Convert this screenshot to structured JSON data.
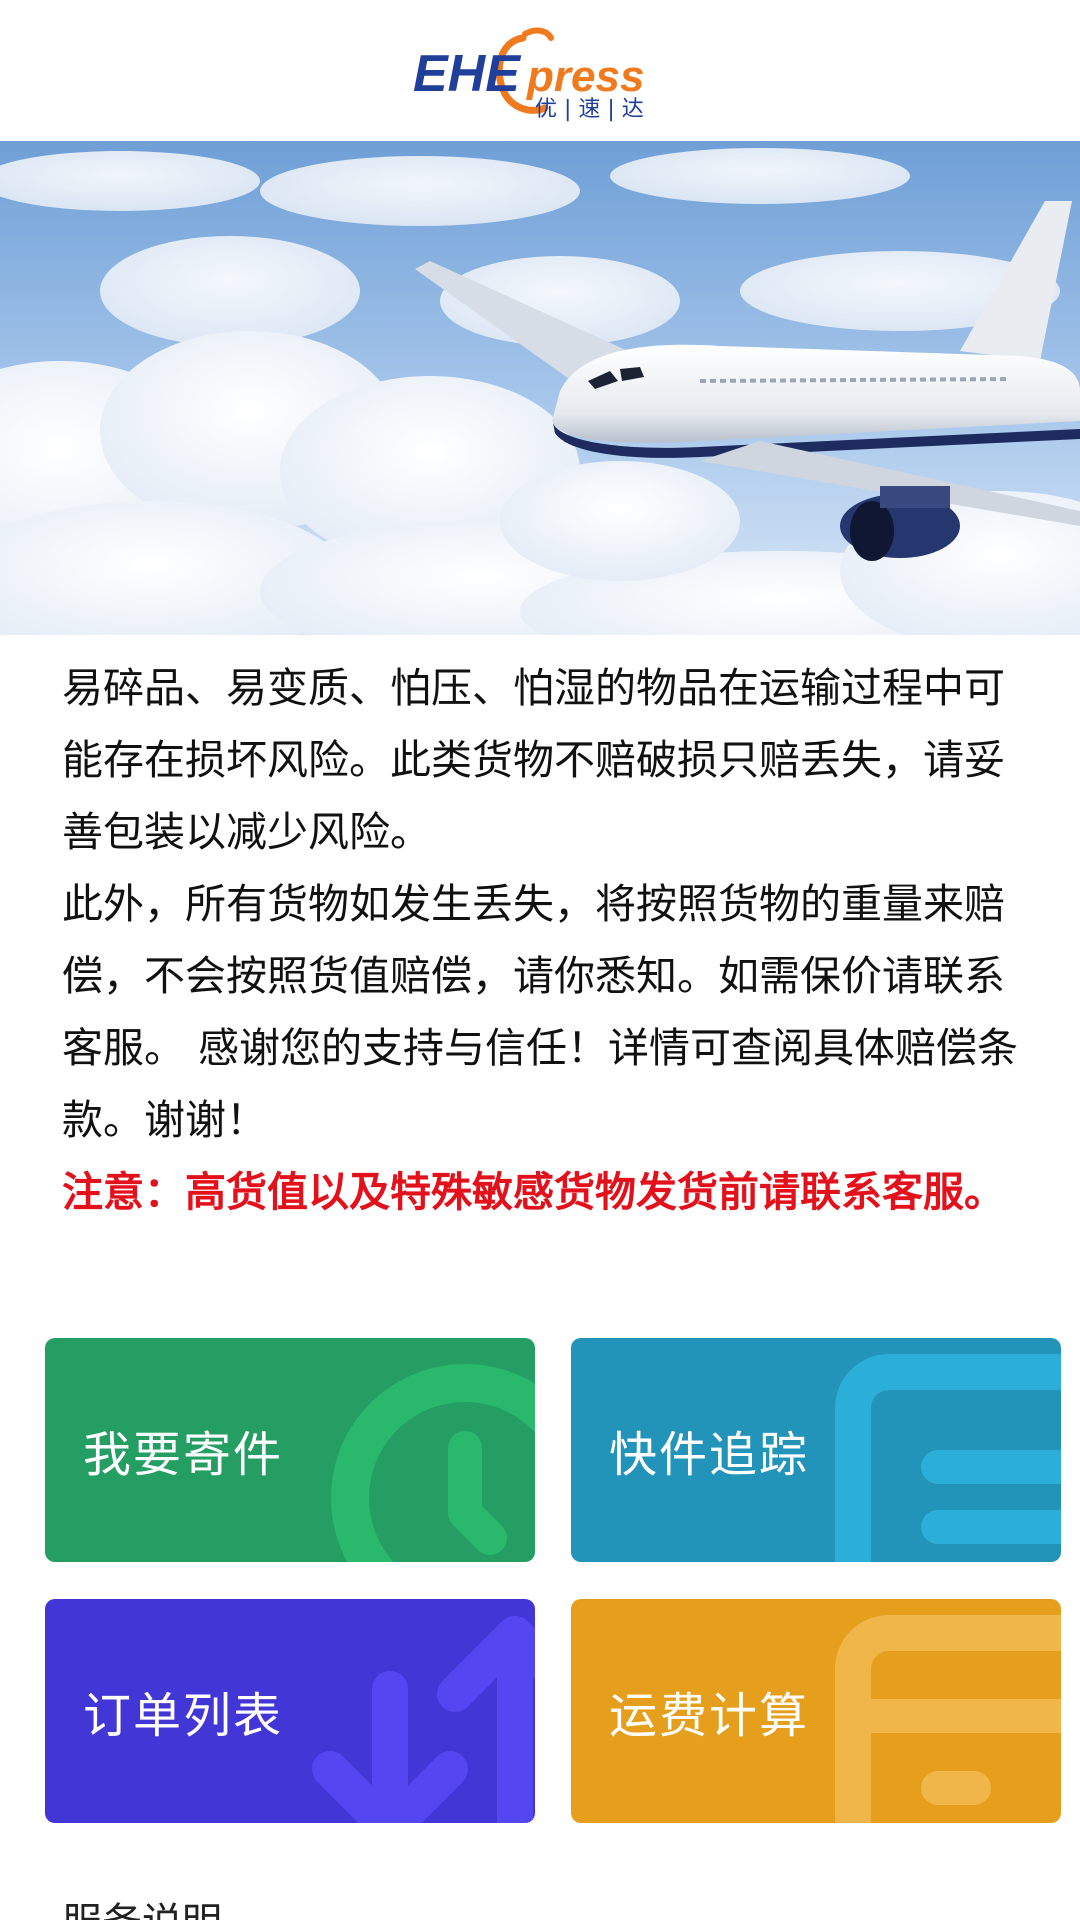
{
  "header": {
    "logo_text": "EHExpress",
    "logo_sub": "优 | 速 | 达"
  },
  "notice": {
    "paragraph1": "易碎品、易变质、怕压、怕湿的物品在运输过程中可能存在损坏风险。此类货物不赔破损只赔丢失，请妥善包装以减少风险。",
    "paragraph2": "此外，所有货物如发生丢失，将按照货物的重量来赔偿，不会按照货值赔偿，请你悉知。如需保价请联系客服。 感谢您的支持与信任！详情可查阅具体赔偿条款。谢谢！",
    "warning": "注意：高货值以及特殊敏感货物发货前请联系客服。"
  },
  "tiles": {
    "send": {
      "label": "我要寄件",
      "color": "#249e63",
      "icon": "clock-icon"
    },
    "track": {
      "label": "快件追踪",
      "color": "#2293b9",
      "icon": "list-icon"
    },
    "orders": {
      "label": "订单列表",
      "color": "#4336d6",
      "icon": "sort-arrows-icon"
    },
    "fee": {
      "label": "运费计算",
      "color": "#e59f1d",
      "icon": "calculator-icon"
    }
  },
  "services": {
    "title": "服务说明"
  },
  "colors": {
    "warning": "#e3111b",
    "logo_blue": "#1f3f9a",
    "logo_orange": "#f07a1e"
  }
}
